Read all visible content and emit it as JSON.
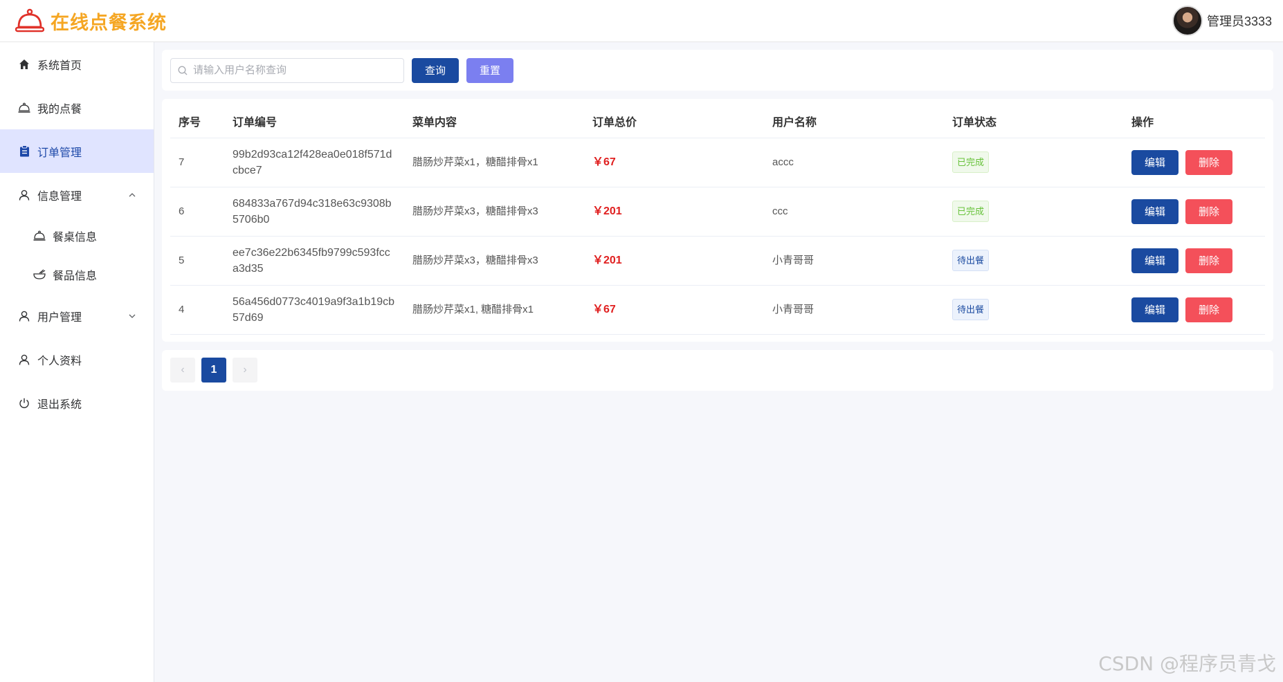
{
  "header": {
    "title": "在线点餐系统",
    "user_name": "管理员3333"
  },
  "sidebar": {
    "items": [
      {
        "label": "系统首页",
        "icon": "home-icon"
      },
      {
        "label": "我的点餐",
        "icon": "bell-dish-icon"
      },
      {
        "label": "订单管理",
        "icon": "clipboard-icon"
      },
      {
        "label": "信息管理",
        "icon": "user-icon"
      },
      {
        "label": "餐桌信息",
        "icon": "bell-dish-icon"
      },
      {
        "label": "餐品信息",
        "icon": "bowl-icon"
      },
      {
        "label": "用户管理",
        "icon": "user-icon"
      },
      {
        "label": "个人资料",
        "icon": "user-icon"
      },
      {
        "label": "退出系统",
        "icon": "power-icon"
      }
    ]
  },
  "search": {
    "placeholder": "请输入用户名称查询",
    "query_label": "查询",
    "reset_label": "重置"
  },
  "table": {
    "columns": [
      "序号",
      "订单编号",
      "菜单内容",
      "订单总价",
      "用户名称",
      "订单状态",
      "操作"
    ],
    "rows": [
      {
        "index": "7",
        "order_no": "99b2d93ca12f428ea0e018f571dcbce7",
        "menu": "腊肠炒芹菜x1，糖醋排骨x1",
        "price": "￥67",
        "user": "accc",
        "status": "已完成",
        "status_type": "done"
      },
      {
        "index": "6",
        "order_no": "684833a767d94c318e63c9308b5706b0",
        "menu": "腊肠炒芹菜x3，糖醋排骨x3",
        "price": "￥201",
        "user": "ccc",
        "status": "已完成",
        "status_type": "done"
      },
      {
        "index": "5",
        "order_no": "ee7c36e22b6345fb9799c593fcca3d35",
        "menu": "腊肠炒芹菜x3，糖醋排骨x3",
        "price": "￥201",
        "user": "小青哥哥",
        "status": "待出餐",
        "status_type": "wait"
      },
      {
        "index": "4",
        "order_no": "56a456d0773c4019a9f3a1b19cb57d69",
        "menu": "腊肠炒芹菜x1, 糖醋排骨x1",
        "price": "￥67",
        "user": "小青哥哥",
        "status": "待出餐",
        "status_type": "wait"
      }
    ],
    "edit_label": "编辑",
    "delete_label": "删除"
  },
  "pagination": {
    "prev": "‹",
    "current": "1",
    "next": "›"
  },
  "watermark": "CSDN @程序员青戈",
  "colors": {
    "brand": "#f5a623",
    "primary": "#1a4aa0",
    "reset": "#7b7ff0",
    "danger": "#f4505a",
    "price": "#e02020",
    "active_nav_bg": "#e0e4ff"
  }
}
